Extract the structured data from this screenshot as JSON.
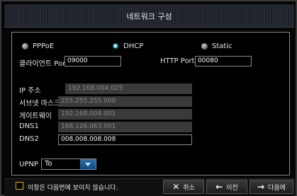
{
  "window": {
    "title": "네트워크 구성"
  },
  "connection": {
    "options": [
      {
        "label": "PPPoE",
        "selected": false
      },
      {
        "label": "DHCP",
        "selected": true
      },
      {
        "label": "Static",
        "selected": false
      }
    ]
  },
  "ports": {
    "client_label": "클라이언트 Port",
    "client_value": "09000",
    "http_label": "HTTP Port",
    "http_value": "00080"
  },
  "addresses": {
    "ip_label": "IP 주소",
    "ip_value": "192.168.004.025",
    "subnet_label": "서브넷 마스크",
    "subnet_value": "255.255.255.000",
    "gateway_label": "게이트웨이",
    "gateway_value": "192.168.004.001",
    "dns1_label": "DNS1",
    "dns1_value": "168.126.063.001",
    "dns2_label": "DNS2",
    "dns2_value": "008.008.008.008"
  },
  "upnp": {
    "label": "UPNP",
    "value": "To"
  },
  "footer": {
    "checkbox_label": "이창은 다음번에 보이지 않습니다.",
    "cancel_label": "취소",
    "prev_label": "이전",
    "next_label": "다음에",
    "cancel_icon": "close-icon",
    "prev_icon": "arrow-left-icon",
    "next_icon": "arrow-right-icon"
  }
}
